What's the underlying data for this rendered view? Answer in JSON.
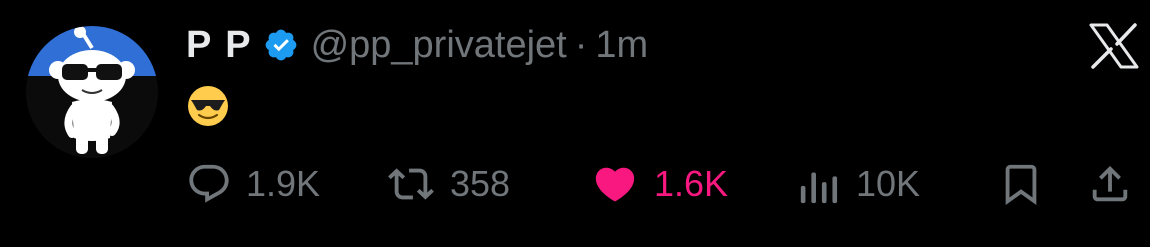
{
  "tweet": {
    "display_name": "P P",
    "handle": "@pp_privatejet",
    "separator": "·",
    "time": "1m",
    "text_emoji": "😎"
  },
  "actions": {
    "replies": "1.9K",
    "reposts": "358",
    "likes": "1.6K",
    "views": "10K"
  },
  "colors": {
    "background": "#000000",
    "primary_text": "#e7e9ea",
    "secondary_text": "#71767b",
    "like_pink": "#f91880",
    "verified_blue": "#1d9bf0",
    "avatar_blue": "#2f6fd6"
  },
  "icons": {
    "verified": "verified-badge-icon",
    "platform": "x-logo-icon",
    "reply": "reply-icon",
    "repost": "repost-icon",
    "like": "heart-icon",
    "views": "views-icon",
    "bookmark": "bookmark-icon",
    "share": "share-icon"
  }
}
